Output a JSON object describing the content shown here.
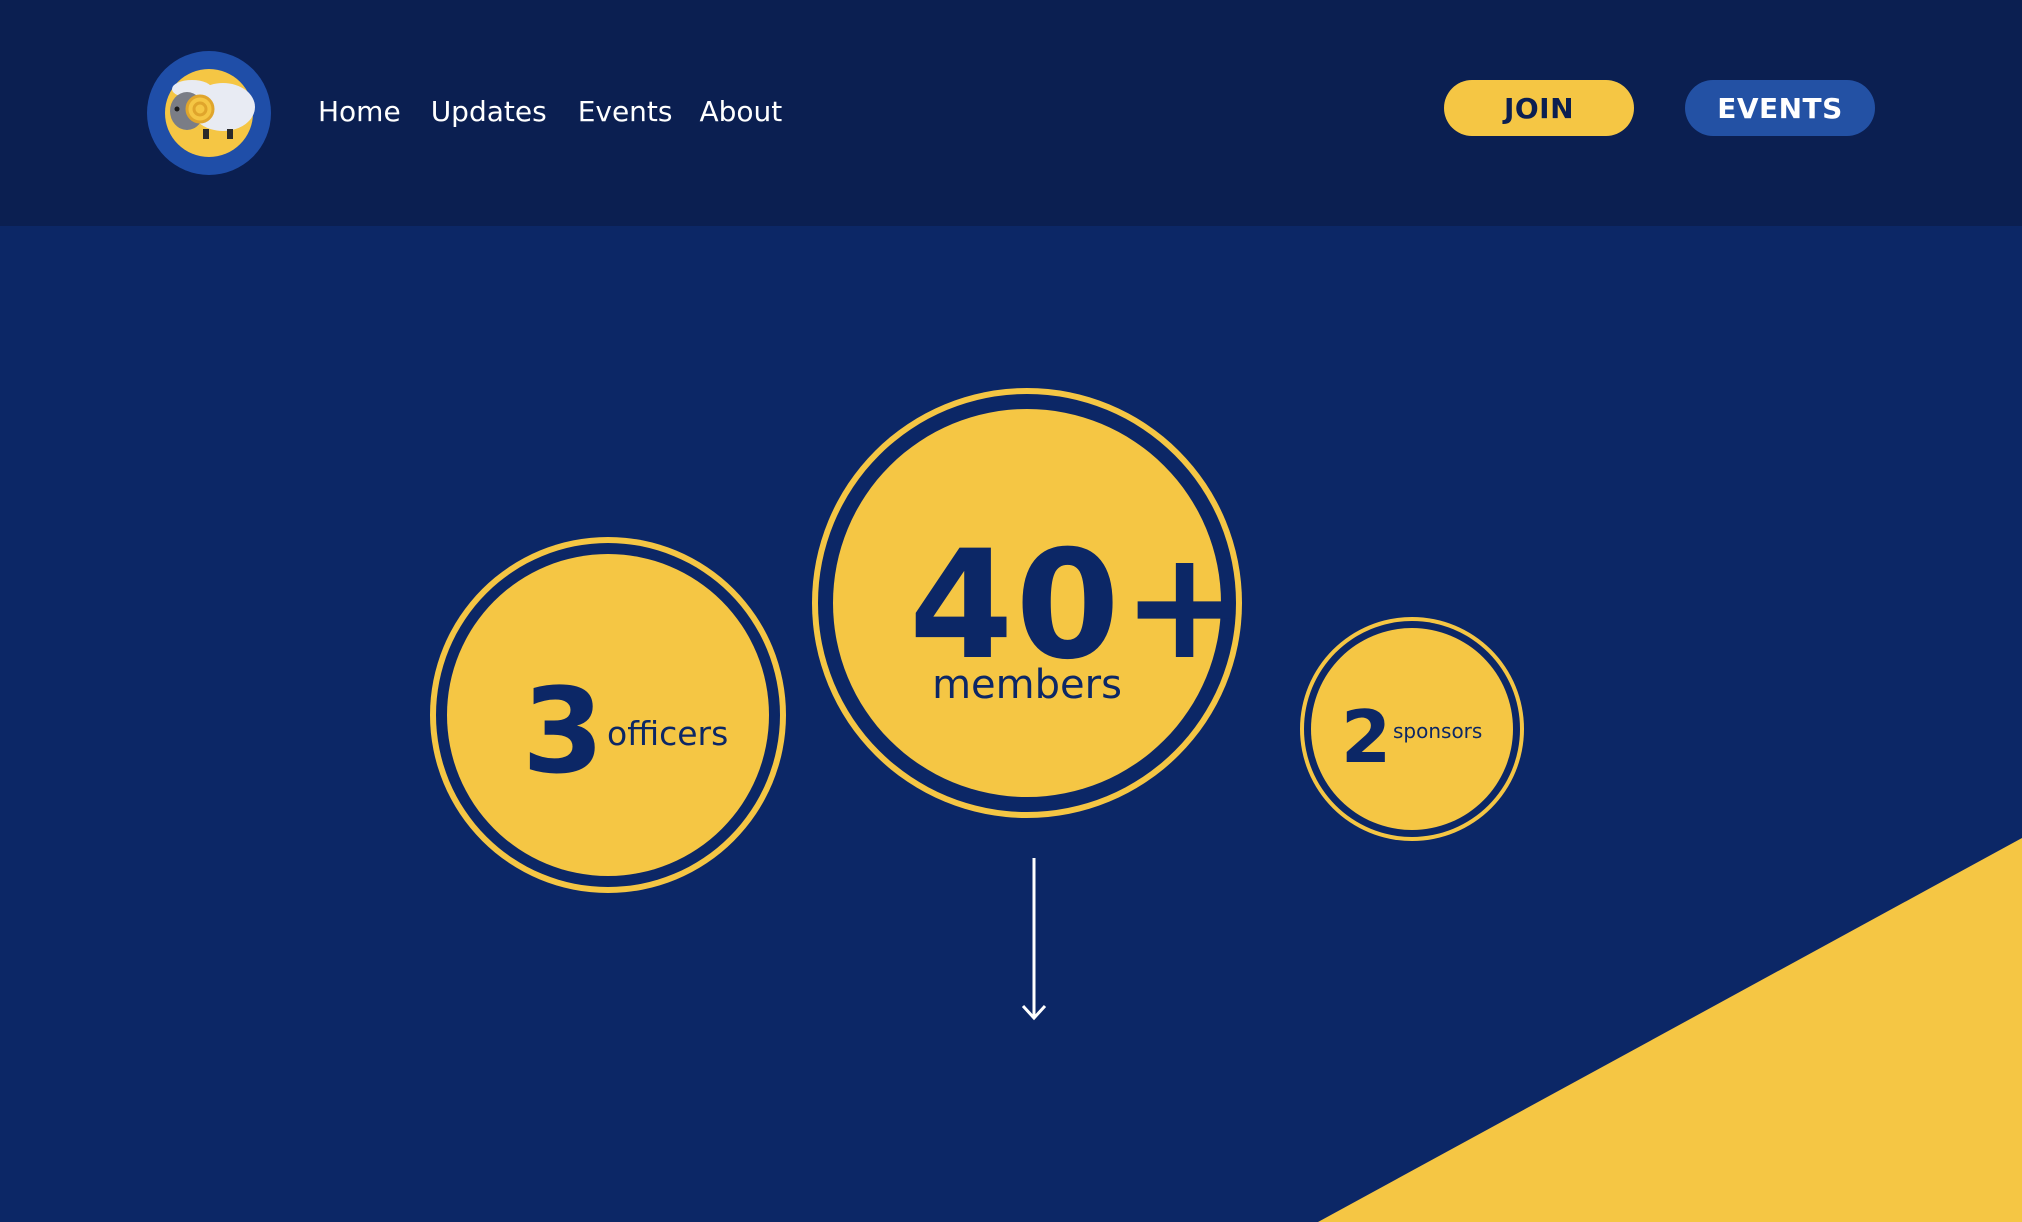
{
  "nav": {
    "items": [
      {
        "label": "Home"
      },
      {
        "label": "Updates"
      },
      {
        "label": "Events"
      },
      {
        "label": "About"
      }
    ]
  },
  "buttons": {
    "join_label": "JOIN",
    "events_label": "EVENTS"
  },
  "stats": {
    "officers": {
      "number": "3",
      "label": "officers"
    },
    "members": {
      "number": "40+",
      "label": "members"
    },
    "sponsors": {
      "number": "2",
      "label": "sponsors"
    }
  },
  "icons": {
    "logo": "ram-icon",
    "scroll": "arrow-down-icon"
  },
  "colors": {
    "header_bg": "#0b1f51",
    "page_bg": "#0c2766",
    "accent_yellow": "#f5c644",
    "accent_blue": "#2351a4"
  }
}
